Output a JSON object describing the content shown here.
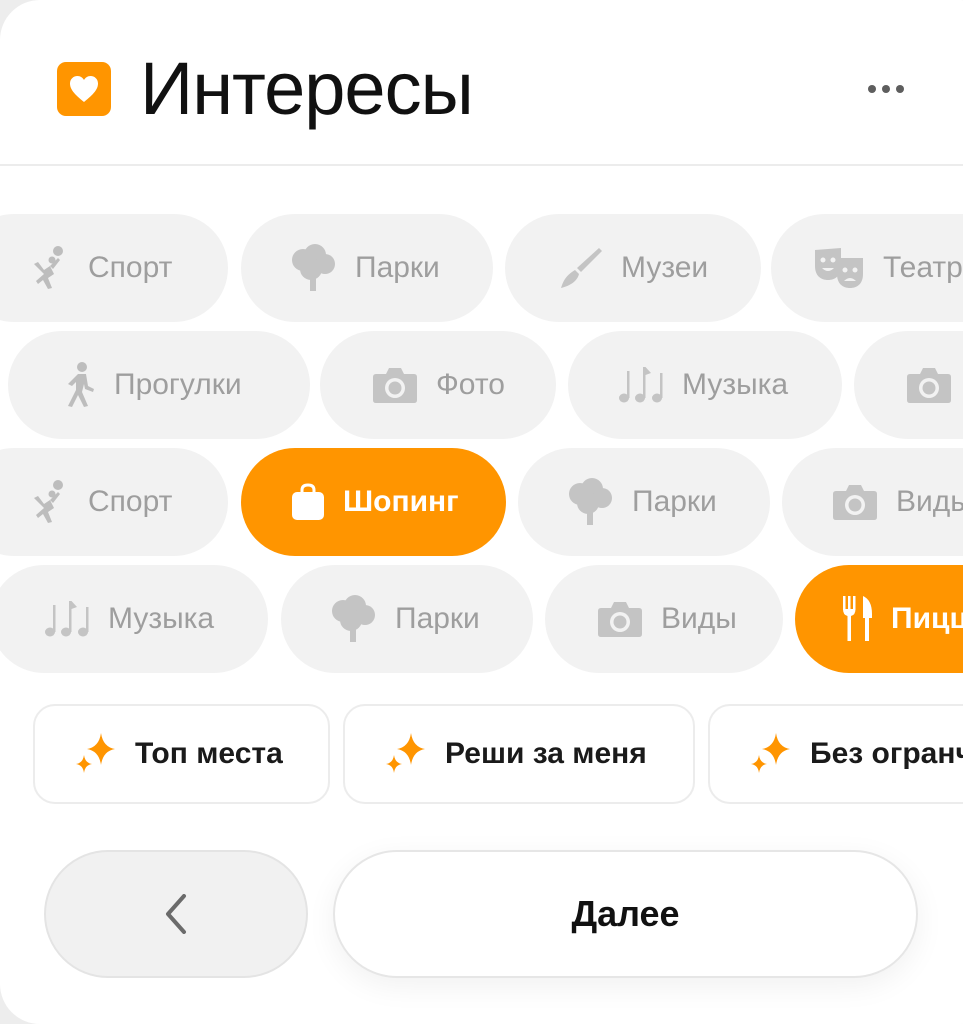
{
  "header": {
    "title": "Интересы",
    "logo_icon": "heart-icon",
    "more_icon": "more-horizontal-icon"
  },
  "colors": {
    "accent": "#ff9500",
    "chip_bg": "#f2f2f2",
    "chip_text": "#9e9e9e",
    "active_text": "#ffffff"
  },
  "rows": [
    [
      {
        "label": "Спорт",
        "icon": "volleyball-player-icon"
      },
      {
        "label": "Парки",
        "icon": "tree-icon"
      },
      {
        "label": "Музеи",
        "icon": "paintbrush-icon"
      },
      {
        "label": "Театр",
        "icon": "theater-masks-icon"
      }
    ],
    [
      {
        "label": "Прогулки",
        "icon": "walking-person-icon"
      },
      {
        "label": "Фото",
        "icon": "camera-icon"
      },
      {
        "label": "Музыка",
        "icon": "music-notes-icon"
      },
      {
        "label": "",
        "icon": "camera-icon"
      }
    ],
    [
      {
        "label": "Спорт",
        "icon": "volleyball-player-icon"
      },
      {
        "label": "Шопинг",
        "icon": "shopping-bag-icon",
        "selected": true
      },
      {
        "label": "Парки",
        "icon": "tree-icon"
      },
      {
        "label": "Виды",
        "icon": "camera-icon"
      }
    ],
    [
      {
        "label": "Музыка",
        "icon": "music-notes-icon"
      },
      {
        "label": "Парки",
        "icon": "tree-icon"
      },
      {
        "label": "Виды",
        "icon": "camera-icon"
      },
      {
        "label": "Пицц",
        "icon": "fork-knife-icon",
        "selected": true
      }
    ]
  ],
  "quick_options": [
    {
      "label": "Топ места",
      "icon": "sparkle-icon"
    },
    {
      "label": "Реши за меня",
      "icon": "sparkle-icon"
    },
    {
      "label": "Без огранч",
      "icon": "sparkle-icon"
    }
  ],
  "footer": {
    "back_icon": "chevron-left-icon",
    "next_label": "Далее"
  }
}
